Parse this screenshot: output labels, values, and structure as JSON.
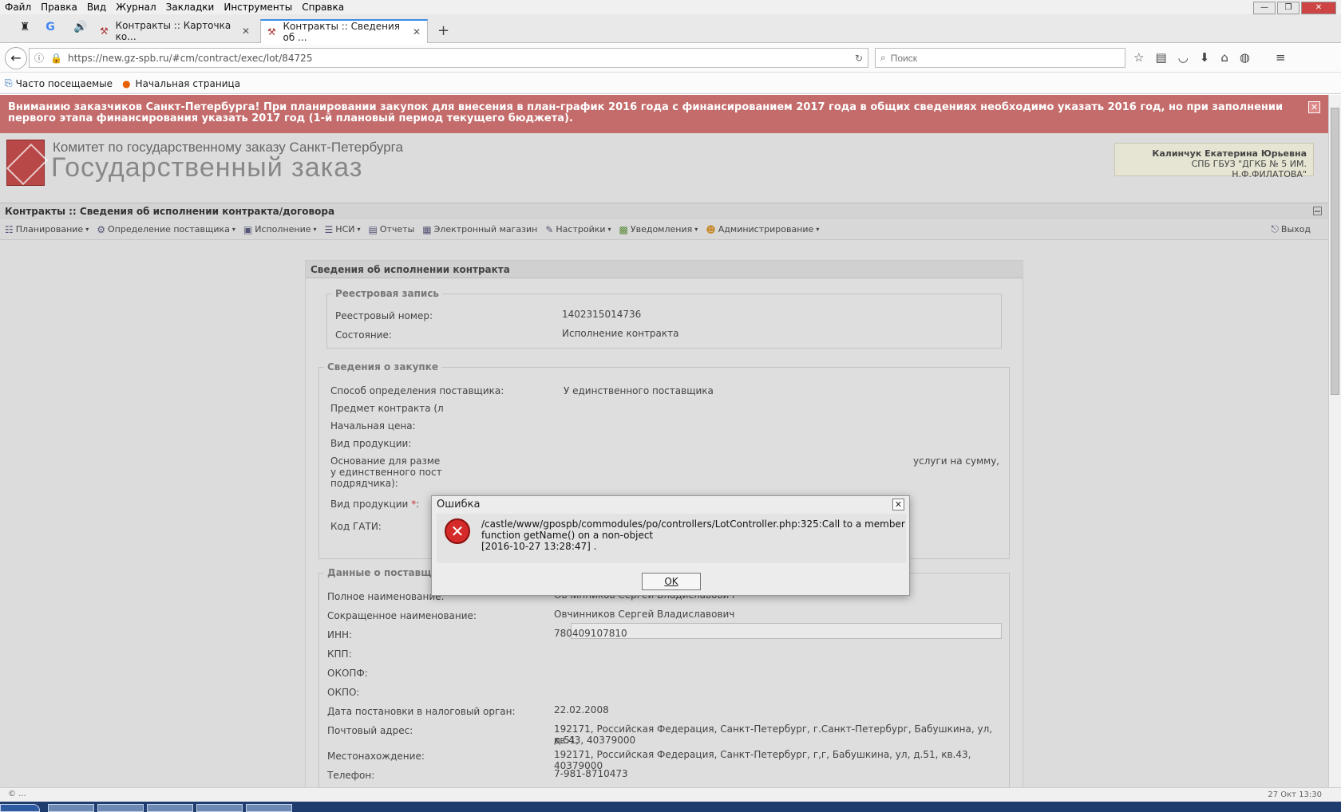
{
  "menubar": [
    "Файл",
    "Правка",
    "Вид",
    "Журнал",
    "Закладки",
    "Инструменты",
    "Справка"
  ],
  "tabs": [
    {
      "label": "Контракты :: Карточка ко...",
      "active": false
    },
    {
      "label": "Контракты :: Сведения об ...",
      "active": true
    }
  ],
  "nav": {
    "url": "https://new.gz-spb.ru/#cm/contract/exec/lot/84725",
    "search_placeholder": "Поиск"
  },
  "bookmarks": [
    "Часто посещаемые",
    "Начальная страница"
  ],
  "notice": "Вниманию заказчиков Санкт-Петербурга! При планировании закупок для внесения в план-график 2016 года с финансированием 2017 года в общих сведениях необходимо указать 2016 год, но при заполнении первого этапа финансирования указать 2017 год (1-й плановый период текущего бюджета).",
  "header": {
    "subtitle": "Комитет по государственному заказу Санкт-Петербурга",
    "title": "Государственный заказ",
    "user_name": "Калинчук Екатерина Юрьевна",
    "user_org": "СПБ ГБУЗ \"ДГКБ № 5 ИМ. Н.Ф.ФИЛАТОВА\""
  },
  "breadcrumb": "Контракты :: Сведения об исполнении контракта/договора",
  "appmenu": {
    "items": [
      "Планирование",
      "Определение поставщика",
      "Исполнение",
      "НСИ",
      "Отчеты",
      "Электронный магазин",
      "Настройки",
      "Уведомления",
      "Администрирование"
    ],
    "exit": "Выход"
  },
  "panel": {
    "title": "Сведения об исполнении контракта",
    "registry": {
      "legend": "Реестровая запись",
      "number_label": "Реестровый номер:",
      "number_value": "1402315014736",
      "state_label": "Состояние:",
      "state_value": "Исполнение контракта"
    },
    "purchase": {
      "legend": "Сведения о закупке",
      "method_label": "Способ определения поставщика:",
      "method_value": "У единственного поставщика",
      "subject_label": "Предмет контракта (л",
      "price_label": "Начальная цена:",
      "product_label": "Вид продукции:",
      "basis_label": "Основание для разме",
      "basis_line2": "у единственного пост",
      "basis_line3": "подрядчика):",
      "basis_tail": "услуги на сумму,",
      "product2_label": "Вид продукции",
      "gati_label": "Код ГАТИ:"
    },
    "supplier": {
      "legend": "Данные о поставщике(исполнителе, подрядчике)",
      "rows": [
        {
          "label": "Полное наименование:",
          "value": "Овчинников Сергей Владиславович"
        },
        {
          "label": "Сокращенное наименование:",
          "value": "Овчинников Сергей Владиславович"
        },
        {
          "label": "ИНН:",
          "value": "780409107810"
        },
        {
          "label": "КПП:",
          "value": ""
        },
        {
          "label": "ОКОПФ:",
          "value": ""
        },
        {
          "label": "ОКПО:",
          "value": ""
        },
        {
          "label": "Дата постановки в налоговый орган:",
          "value": "22.02.2008"
        },
        {
          "label": "Почтовый адрес:",
          "value": "192171, Российская Федерация, Санкт-Петербург, г.Санкт-Петербург, Бабушкина, ул, д.51,"
        },
        {
          "label": "",
          "value": "кв.43, 40379000"
        },
        {
          "label": "Местонахождение:",
          "value": "192171, Российская Федерация, Санкт-Петербург, г,г, Бабушкина, ул, д.51, кв.43, 40379000"
        },
        {
          "label": "Телефон:",
          "value": "7-981-8710473"
        }
      ]
    }
  },
  "modal": {
    "title": "Ошибка",
    "message": "/castle/www/gpospb/commodules/po/controllers/LotController.php:325:Call to a member\nfunction getName() on a non-object\n[2016-10-27 13:28:47] .",
    "ok_label": "OK"
  },
  "status": {
    "left": "© ...",
    "clock": "27 Окт 13:30"
  }
}
